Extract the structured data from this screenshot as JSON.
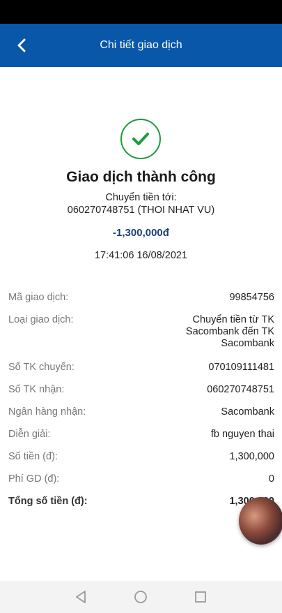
{
  "header": {
    "title": "Chi tiết giao dịch",
    "back_icon": "chevron-left-icon"
  },
  "summary": {
    "icon": "checkmark-circle-icon",
    "status": "Giao dịch thành công",
    "transfer_to_label": "Chuyển tiền tới:",
    "transfer_to_account": "060270748751 (THOI NHAT VU)",
    "amount": "-1,300,000đ",
    "timestamp": "17:41:06 16/08/2021"
  },
  "details": [
    {
      "label": "Mã giao dịch:",
      "value": "99854756"
    },
    {
      "label": "Loại giao dịch:",
      "value_lines": [
        "Chuyển tiền từ TK",
        "Sacombank đến TK",
        "Sacombank"
      ]
    },
    {
      "label": "Số TK chuyển:",
      "value": "070109111481"
    },
    {
      "label": "Số TK nhận:",
      "value": "060270748751"
    },
    {
      "label": "Ngân hàng nhận:",
      "value": "Sacombank"
    },
    {
      "label": "Diễn giải:",
      "value": "fb nguyen thai"
    },
    {
      "label": "Số tiền (đ):",
      "value": "1,300,000"
    },
    {
      "label": "Phí GD (đ):",
      "value": "0"
    },
    {
      "label": "Tổng số tiền (đ):",
      "value": "1,300,000"
    }
  ],
  "nav": {
    "back_icon": "triangle-back-icon",
    "home_icon": "circle-home-icon",
    "recents_icon": "square-recents-icon"
  },
  "colors": {
    "header_bg": "#0857a8",
    "success": "#1e9a3c",
    "amount": "#1d3f78"
  }
}
